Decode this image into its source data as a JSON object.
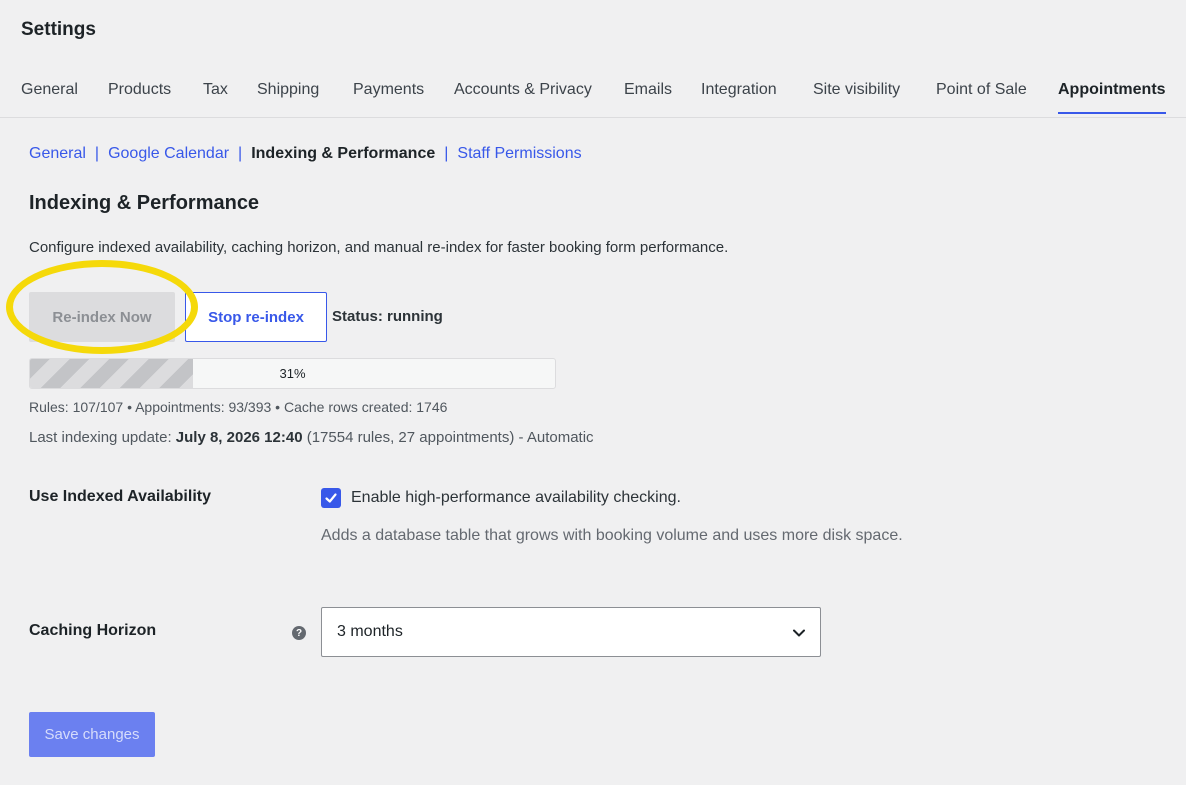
{
  "page": {
    "title": "Settings"
  },
  "tabs": [
    {
      "label": "General"
    },
    {
      "label": "Products"
    },
    {
      "label": "Tax"
    },
    {
      "label": "Shipping"
    },
    {
      "label": "Payments"
    },
    {
      "label": "Accounts & Privacy"
    },
    {
      "label": "Emails"
    },
    {
      "label": "Integration"
    },
    {
      "label": "Site visibility"
    },
    {
      "label": "Point of Sale"
    },
    {
      "label": "Appointments"
    }
  ],
  "subnav": {
    "general": "General",
    "google_calendar": "Google Calendar",
    "indexing": "Indexing & Performance",
    "staff": "Staff Permissions",
    "separator": "|"
  },
  "section": {
    "title": "Indexing & Performance",
    "description": "Configure indexed availability, caching horizon, and manual re-index for faster booking form performance."
  },
  "actions": {
    "reindex_label": "Re-index Now",
    "stop_label": "Stop re-index",
    "status_text": "Status: running"
  },
  "progress": {
    "percent": 31,
    "label": "31%"
  },
  "stats": {
    "text": "Rules: 107/107 • Appointments: 93/393 • Cache rows created: 1746"
  },
  "last_update": {
    "prefix": "Last indexing update: ",
    "date": "July 8, 2026 12:40",
    "suffix": " (17554 rules, 27 appointments) - Automatic"
  },
  "indexed_availability": {
    "label": "Use Indexed Availability",
    "checkbox_label": "Enable high-performance availability checking.",
    "checked": true,
    "description": "Adds a database table that grows with booking volume and uses more disk space."
  },
  "caching_horizon": {
    "label": "Caching Horizon",
    "selected": "3 months"
  },
  "save": {
    "label": "Save changes"
  },
  "colors": {
    "accent": "#3858e9",
    "highlight": "#f5d90a",
    "background": "#f0f0f1"
  }
}
